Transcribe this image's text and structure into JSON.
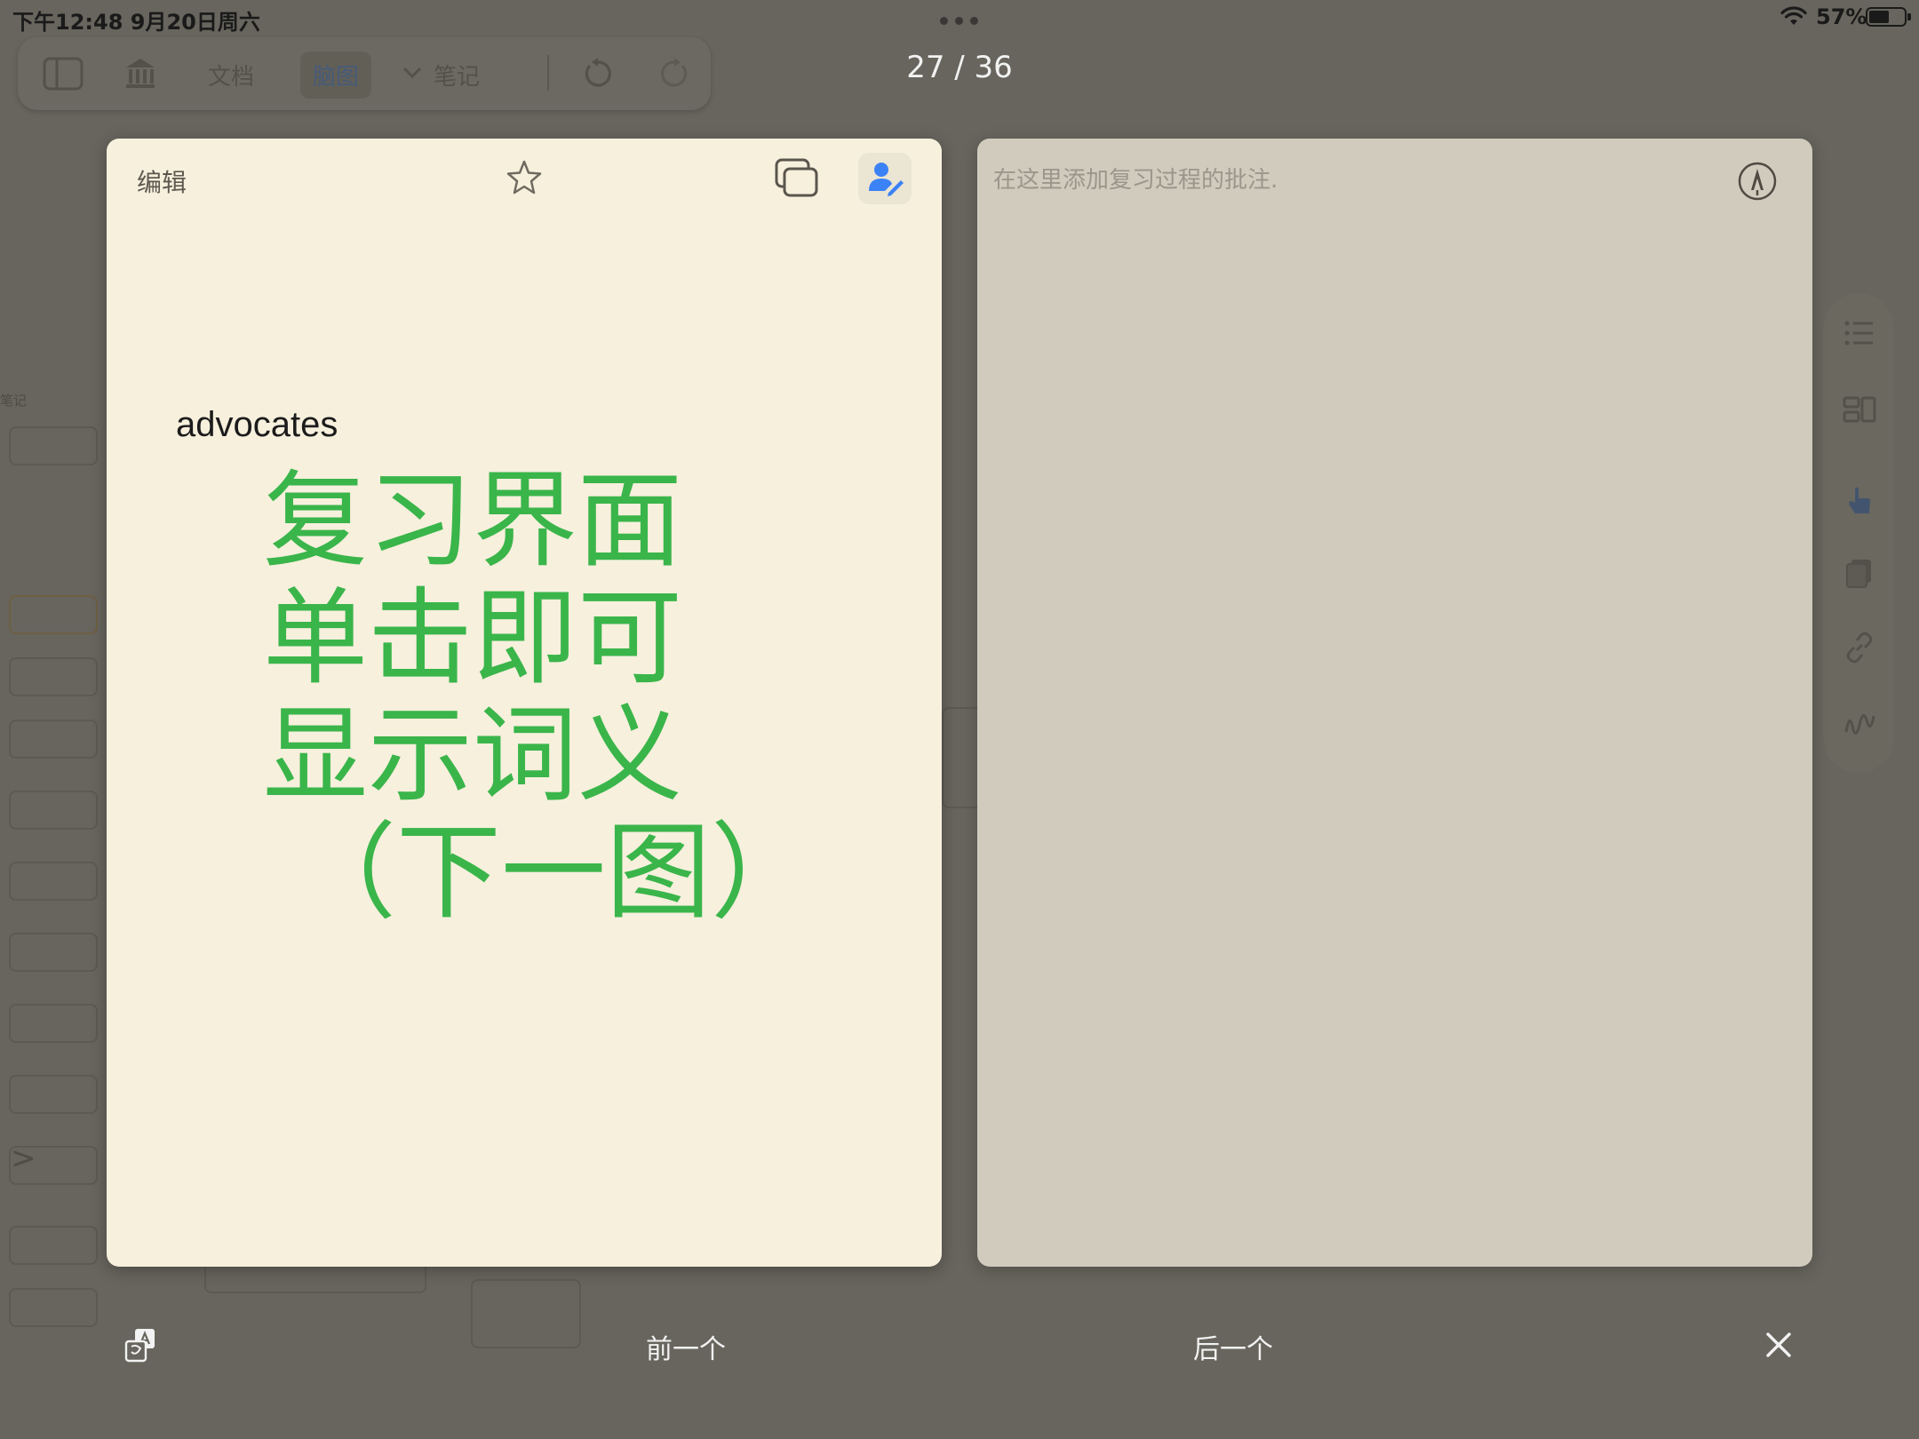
{
  "status_bar": {
    "time": "下午12:48   9月20日周六",
    "battery_percent": "57%",
    "battery_level": 0.57
  },
  "background_toolbar": {
    "items": [
      "文档",
      "脑图",
      "笔记"
    ],
    "active_item": "脑图"
  },
  "page_indicator": "27 / 36",
  "card_front": {
    "edit_label": "编辑",
    "word": "advocates",
    "overlay_lines": [
      "复习界面",
      "单击即可",
      "显示词义",
      "（下一图）"
    ]
  },
  "card_back": {
    "note_placeholder": "在这里添加复习过程的批注."
  },
  "bottom_bar": {
    "prev_label": "前一个",
    "next_label": "后一个"
  },
  "background_left_panel": {
    "label": "笔记"
  },
  "colors": {
    "overlay_text": "#3ab54a",
    "card_front_bg": "#f7f0dd",
    "card_back_bg": "#d1cbbe",
    "dim_background": "#67655d",
    "accent_blue": "#3b82f6"
  }
}
